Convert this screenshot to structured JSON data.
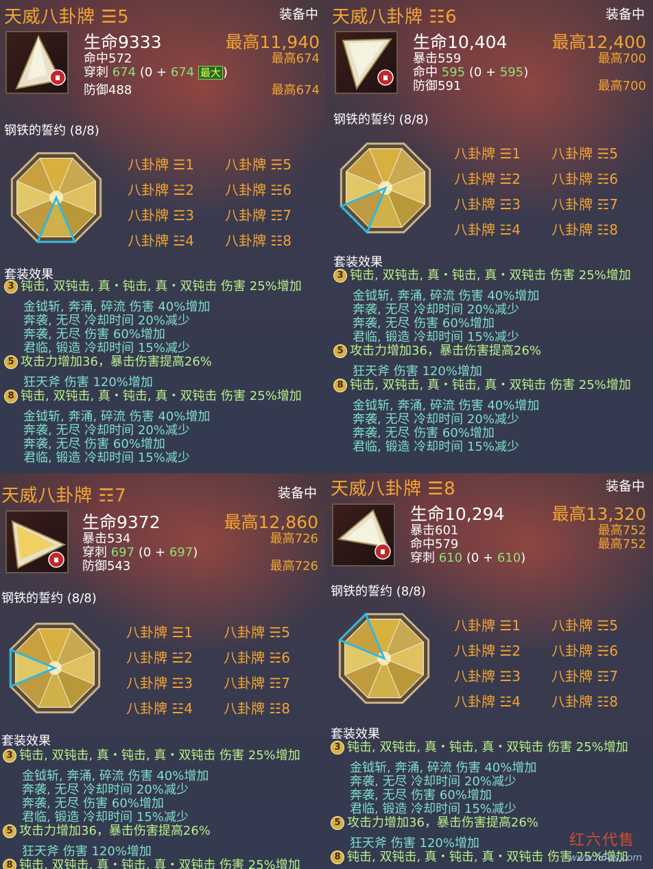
{
  "panels": [
    {
      "title": "天威八卦牌 ☰5",
      "equipped": "装备中",
      "stats": [
        "生命9333",
        "命中572",
        "穿刺 674 (0 + 674 最大)",
        "防御488"
      ],
      "stats_rich": {
        "hp": "生命9333",
        "l2": "命中572",
        "pierce_label": "穿刺 ",
        "pierce_val": "674",
        "pierce_rest": " (0 + ",
        "pierce_add": "674",
        "pierce_tag": "最大",
        "pierce_end": ")",
        "l4": "防御488"
      },
      "maxes": {
        "m1": "最高11,940",
        "m2": "最高674",
        "m3": "",
        "m4": "最高674"
      },
      "set_name": "钢铁的誓约 (8/8)",
      "highlight_slot": 4
    },
    {
      "title": "天威八卦牌 ☷6",
      "equipped": "装备中",
      "stats_rich": {
        "hp": "生命10,404",
        "l2": "暴击559",
        "l3a": "命中 ",
        "l3b": "595",
        "l3c": " (0 + ",
        "l3d": "595",
        "l3e": ")",
        "l4": "防御591"
      },
      "maxes": {
        "m1": "最高12,400",
        "m2": "最高700",
        "m3": "",
        "m4": "最高700"
      },
      "set_name": "钢铁的誓约 (8/8)",
      "highlight_slot": 5
    },
    {
      "title": "天威八卦牌 ☶7",
      "equipped": "装备中",
      "stats_rich": {
        "hp": "生命9372",
        "l2": "暴击534",
        "l3a": "穿刺 ",
        "l3b": "697",
        "l3c": " (0 + ",
        "l3d": "697",
        "l3e": ")",
        "l4": "防御543"
      },
      "maxes": {
        "m1": "最高12,860",
        "m2": "最高726",
        "m3": "",
        "m4": "最高726"
      },
      "set_name": "钢铁的誓约 (8/8)",
      "highlight_slot": 6
    },
    {
      "title": "天威八卦牌 ☰8",
      "equipped": "装备中",
      "stats_rich": {
        "hp": "生命10,294",
        "l2": "暴击601",
        "l3": "命中579",
        "l4a": "穿刺 ",
        "l4b": "610",
        "l4c": " (0 + ",
        "l4d": "610",
        "l4e": ")"
      },
      "maxes": {
        "m1": "最高13,320",
        "m2": "最高752",
        "m3": "最高752",
        "m4": ""
      },
      "set_name": "钢铁的誓约 (8/8)",
      "highlight_slot": 7
    }
  ],
  "pieces": [
    "八卦牌 ☰1",
    "八卦牌 ☱2",
    "八卦牌 ☲3",
    "八卦牌 ☳4",
    "八卦牌 ☴5",
    "八卦牌 ☵6",
    "八卦牌 ☶7",
    "八卦牌 ☷8"
  ],
  "effects": {
    "title": "套装效果",
    "tier3_num": "3",
    "tier3_head": "钝击, 双钝击, 真・钝击, 真・双钝击 伤害 25%增加",
    "tier3_l1": "金钺斩, 奔涌, 碎流 伤害 40%增加",
    "tier3_l2": "奔袭, 无尽 冷却时间 20%减少",
    "tier3_l3": "奔袭, 无尽 伤害 60%增加",
    "tier3_l4": "君临, 锻造 冷却时间 15%减少",
    "tier5_num": "5",
    "tier5_head": "攻击力增加36，暴击伤害提高26%",
    "tier5_l1": "狂天斧 伤害 120%增加",
    "tier8_num": "8",
    "tier8_head": "钝击, 双钝击, 真・钝击, 真・双钝击 伤害 25%增加",
    "tier8_l1": "金钺斩, 奔涌, 碎流 伤害 40%增加",
    "tier8_l2": "奔袭, 无尽 冷却时间 20%减少",
    "tier8_l3": "奔袭, 无尽 伤害 60%增加",
    "tier8_l4": "君临, 锻造 冷却时间 15%减少"
  },
  "watermark": {
    "name": "红六代售",
    "url": "www.h6ds.com"
  },
  "colors": {
    "title": "#f2a533",
    "effect": "#7fe0c8",
    "effect_head": "#b9f08a",
    "highlight": "#2fb8e0"
  }
}
